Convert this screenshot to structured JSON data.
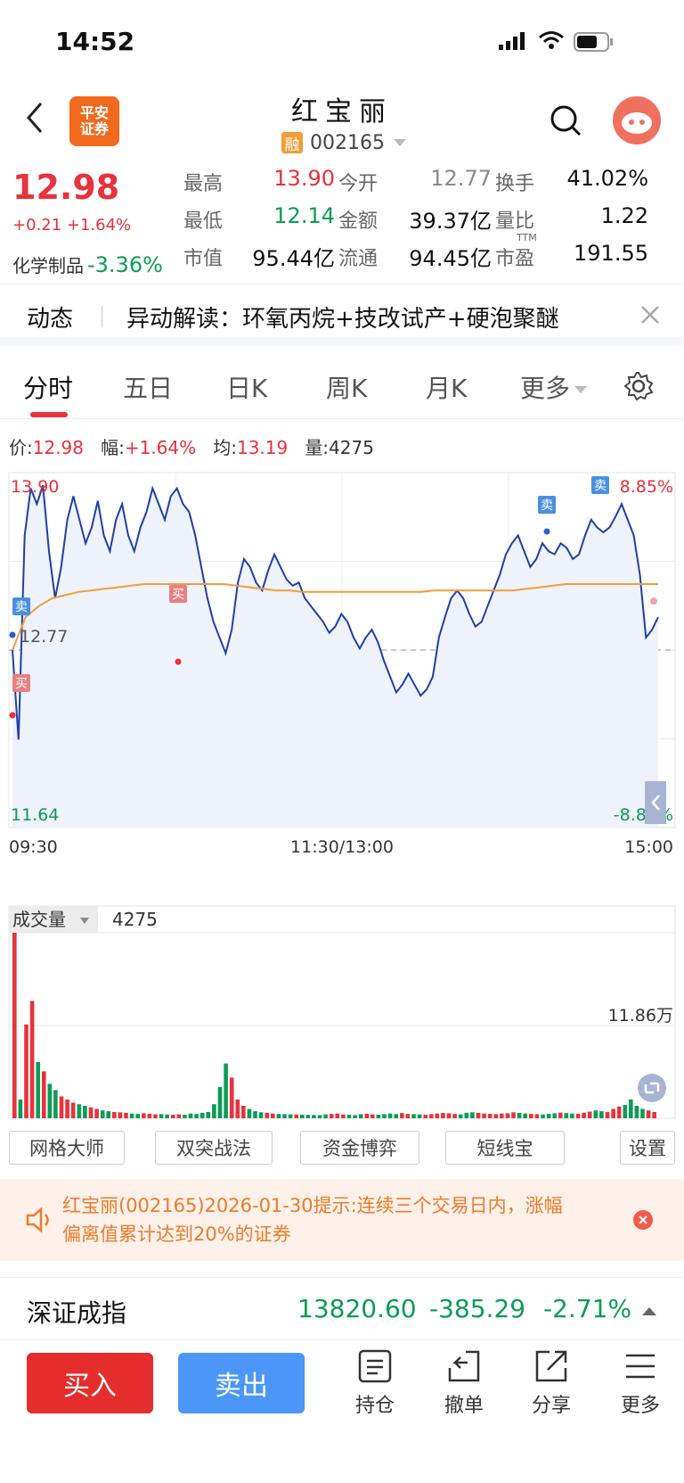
{
  "status_bar": {
    "time": "14:52"
  },
  "header": {
    "title": "红宝丽",
    "code": "002165",
    "margin_badge": "融",
    "logo_line1": "平安",
    "logo_line2": "证券"
  },
  "quote": {
    "price": "12.98",
    "change": "+0.21 +1.64%",
    "sector_name": "化学制品",
    "sector_change": "-3.36%",
    "stats": [
      {
        "label": "最高",
        "value": "13.90",
        "color": "red"
      },
      {
        "label": "今开",
        "value": "12.77",
        "color": "gray"
      },
      {
        "label": "换手",
        "value": "41.02%",
        "color": "black"
      },
      {
        "label": "最低",
        "value": "12.14",
        "color": "green"
      },
      {
        "label": "金额",
        "value": "39.37亿",
        "color": "black"
      },
      {
        "label": "量比",
        "value": "1.22",
        "color": "black"
      },
      {
        "label": "市值",
        "value": "95.44亿",
        "color": "black"
      },
      {
        "label": "流通",
        "value": "94.45亿",
        "color": "black"
      },
      {
        "label": "市盈",
        "value": "191.55",
        "color": "black",
        "sup": "TTM"
      }
    ]
  },
  "news": {
    "tab": "动态",
    "headline": "异动解读：环氧丙烷+技改试产+硬泡聚醚"
  },
  "tabs": [
    {
      "label": "分时",
      "active": true
    },
    {
      "label": "五日",
      "active": false
    },
    {
      "label": "日K",
      "active": false
    },
    {
      "label": "周K",
      "active": false
    },
    {
      "label": "月K",
      "active": false
    },
    {
      "label": "更多",
      "active": false
    }
  ],
  "chart_info": {
    "price_label": "价:",
    "price": "12.98",
    "amp_label": "幅:",
    "amp": "+1.64%",
    "avg_label": "均:",
    "avg": "13.19",
    "vol_label": "量:",
    "vol": "4275"
  },
  "chart_data": {
    "type": "line",
    "y_top_label": "13.90",
    "y_bottom_label": "11.64",
    "y_mid_label": "12.77",
    "pct_top": "8.85%",
    "pct_bottom": "-8.85%",
    "ylim": [
      11.64,
      13.9
    ],
    "x_labels": [
      "09:30",
      "11:30/13:00",
      "15:00"
    ],
    "series": [
      {
        "values": [
          12.77,
          12.2,
          13.5,
          13.8,
          13.7,
          13.82,
          13.4,
          13.1,
          13.3,
          13.6,
          13.75,
          13.6,
          13.45,
          13.55,
          13.72,
          13.5,
          13.4,
          13.6,
          13.7,
          13.5,
          13.4,
          13.55,
          13.65,
          13.8,
          13.7,
          13.6,
          13.75,
          13.8,
          13.7,
          13.65,
          13.5,
          13.3,
          13.1,
          12.95,
          12.85,
          12.75,
          12.9,
          13.2,
          13.35,
          13.3,
          13.2,
          13.15,
          13.28,
          13.38,
          13.3,
          13.22,
          13.18,
          13.2,
          13.1,
          13.05,
          13.0,
          12.95,
          12.88,
          12.92,
          13.0,
          12.95,
          12.85,
          12.78,
          12.85,
          12.9,
          12.82,
          12.7,
          12.6,
          12.5,
          12.55,
          12.62,
          12.55,
          12.48,
          12.52,
          12.6,
          12.85,
          12.98,
          13.1,
          13.15,
          13.1,
          13.0,
          12.92,
          12.95,
          13.05,
          13.15,
          13.25,
          13.38,
          13.45,
          13.5,
          13.4,
          13.3,
          13.35,
          13.45,
          13.4,
          13.38,
          13.45,
          13.42,
          13.35,
          13.38,
          13.5,
          13.6,
          13.55,
          13.52,
          13.55,
          13.62,
          13.7,
          13.6,
          13.5,
          13.25,
          12.85,
          12.9,
          12.98
        ]
      },
      {
        "values": [
          12.77,
          12.98,
          13.05,
          13.1,
          13.12,
          13.14,
          13.15,
          13.16,
          13.17,
          13.18,
          13.19,
          13.19,
          13.19,
          13.19,
          13.19,
          13.19,
          13.19,
          13.18,
          13.17,
          13.16,
          13.15,
          13.15,
          13.14,
          13.14,
          13.14,
          13.14,
          13.14,
          13.14,
          13.14,
          13.14,
          13.14,
          13.14,
          13.15,
          13.15,
          13.15,
          13.15,
          13.15,
          13.15,
          13.15,
          13.16,
          13.17,
          13.18,
          13.19,
          13.19,
          13.19,
          13.19,
          13.19,
          13.19,
          13.19,
          13.19
        ]
      }
    ],
    "volume_label": "成交量",
    "volume_value": "4275",
    "volume_max_label": "11.86万",
    "volume": [
      118600,
      12000,
      60000,
      75000,
      36000,
      30000,
      22000,
      18000,
      14000,
      12000,
      10000,
      9000,
      8000,
      7000,
      6000,
      5000,
      4500,
      4000,
      3800,
      3500,
      3000,
      2800,
      3200,
      2900,
      2500,
      2600,
      2400,
      2200,
      2500,
      2300,
      3000,
      2800,
      3500,
      4000,
      9000,
      20000,
      35000,
      26000,
      12000,
      8000,
      6000,
      4500,
      3800,
      3500,
      3000,
      2800,
      2600,
      2500,
      2400,
      2300,
      2200,
      2100,
      2000,
      2500,
      2800,
      3000,
      2400,
      2200,
      2000,
      2600,
      2900,
      2500,
      2300,
      2600,
      3000,
      2700,
      3300,
      2800,
      2600,
      2400,
      2200,
      2600,
      3000,
      3400,
      3200,
      2800,
      2500,
      3500,
      3800,
      3400,
      3000,
      2800,
      2600,
      3000,
      3200,
      3800,
      3400,
      3000,
      2800,
      2600,
      2400,
      2800,
      3200,
      3600,
      3300,
      3000,
      2800,
      3600,
      4200,
      5000,
      4500,
      4000,
      6000,
      7500,
      8500,
      12000,
      8000,
      6000,
      5000,
      4000
    ]
  },
  "tool_buttons": [
    "网格大师",
    "双突战法",
    "资金博弈",
    "短线宝",
    "设置"
  ],
  "alert": {
    "line1": "红宝丽(002165)2026-01-30提示:连续三个交易日内，涨幅",
    "line2": "偏离值累计达到20%的证券"
  },
  "index": {
    "name": "深证成指",
    "value": "13820.60",
    "change": "-385.29",
    "pct": "-2.71%"
  },
  "bottom": {
    "buy": "买入",
    "sell": "卖出",
    "tools": [
      {
        "label": "持仓",
        "icon": "holdings-icon"
      },
      {
        "label": "撤单",
        "icon": "cancel-order-icon"
      },
      {
        "label": "分享",
        "icon": "share-icon"
      },
      {
        "label": "更多",
        "icon": "more-icon"
      }
    ]
  },
  "markers": {
    "buy": "买",
    "sell": "卖"
  },
  "colors": {
    "up": "#e8323c",
    "down": "#0a9d56",
    "price_line": "#1f3fa8",
    "avg_line": "#f29d38",
    "accent_blue": "#4a97f7"
  }
}
